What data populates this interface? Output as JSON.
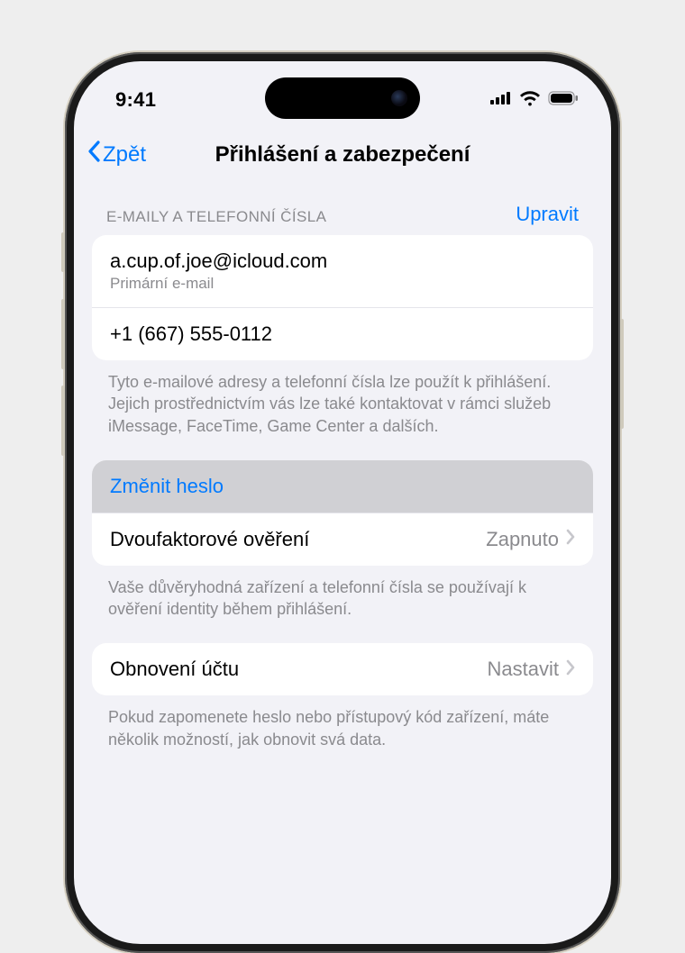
{
  "status": {
    "time": "9:41"
  },
  "nav": {
    "back": "Zpět",
    "title": "Přihlášení a zabezpečení"
  },
  "contacts_section": {
    "header": "E-MAILY A TELEFONNÍ ČÍSLA",
    "edit": "Upravit",
    "email": "a.cup.of.joe@icloud.com",
    "email_sub": "Primární e-mail",
    "phone": "+1 (667) 555-0112",
    "footer": "Tyto e-mailové adresy a telefonní čísla lze použít k přihlášení. Jejich prostřednictvím vás lze také kontaktovat v rámci služeb iMessage, FaceTime, Game Center a dalších."
  },
  "security_section": {
    "change_password": "Změnit heslo",
    "twofactor_label": "Dvoufaktorové ověření",
    "twofactor_value": "Zapnuto",
    "footer": "Vaše důvěryhodná zařízení a telefonní čísla se používají k ověření identity během přihlášení."
  },
  "recovery_section": {
    "label": "Obnovení účtu",
    "value": "Nastavit",
    "footer": "Pokud zapomenete heslo nebo přístupový kód zařízení, máte několik možností, jak obnovit svá data."
  }
}
